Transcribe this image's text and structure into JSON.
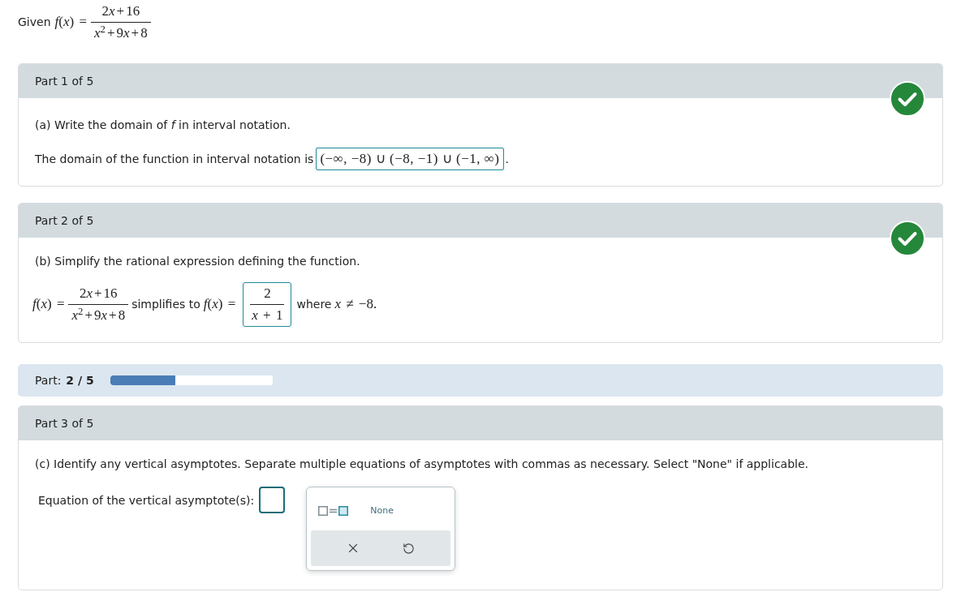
{
  "given": {
    "label": "Given",
    "lhs": "f(x) =",
    "numerator": "2x+16",
    "denominator": "x$^{2}$+9x+8"
  },
  "completed_parts": [
    {
      "kind": "domain",
      "title": "Part 1 of 5",
      "correct": true,
      "question": "(a) Write the domain of *f* in interval notation.",
      "answer_label": "The domain of the function in interval notation is",
      "answer": "(−∞, −8) ∪ (−8, −1) ∪ (−1, ∞)",
      "suffix": "."
    },
    {
      "kind": "simplify",
      "title": "Part 2 of 5",
      "correct": true,
      "question": "(b) Simplify the rational expression defining the function.",
      "lhs": "f(x) =",
      "numerator": "2x+16",
      "denominator": "x$^{2}$+9x+8",
      "middle": "simplifies to",
      "answer_lhs": "f(x) =",
      "answer_numerator": "2",
      "answer_denominator": "x + 1",
      "condition_label": "where",
      "condition": "x ≠ −8."
    }
  ],
  "progress": {
    "label": "Part:",
    "value": "2 / 5",
    "level": 0.4
  },
  "current_part": {
    "title": "Part 3 of 5",
    "question": "(c) Identify any vertical asymptotes. Separate multiple equations of asymptotes with commas as necessary. Select \"None\" if applicable.",
    "answer_label": "Equation of the vertical asymptote(s):",
    "keypad": {
      "none_button": "None"
    }
  }
}
